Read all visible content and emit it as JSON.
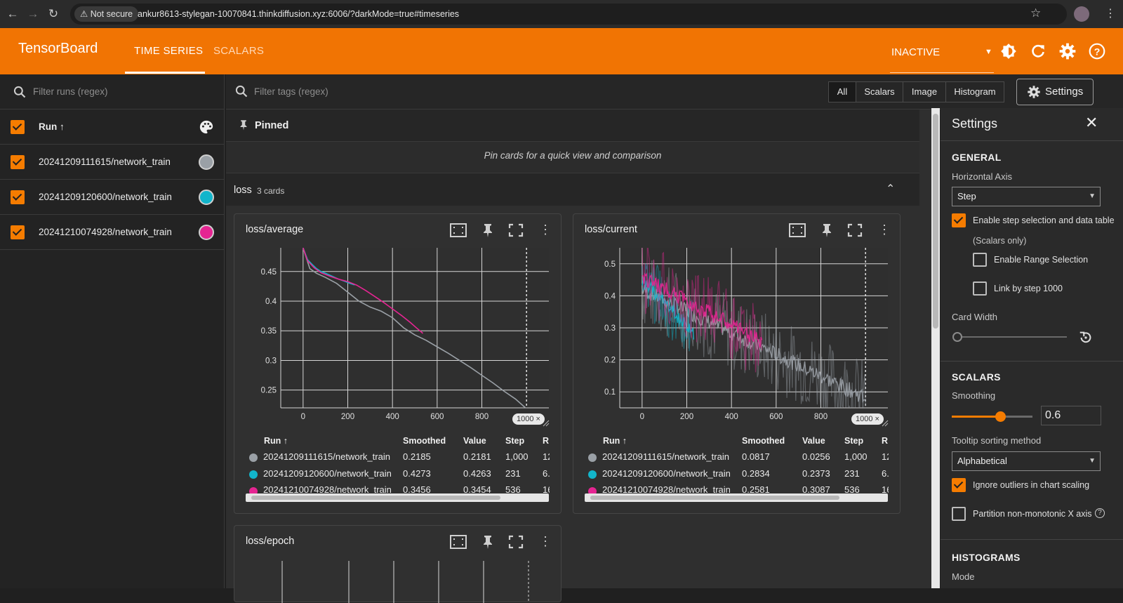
{
  "browser": {
    "security_label": "Not secure",
    "url": "ankur8613-stylegan-10070841.thinkdiffusion.xyz:6006/?darkMode=true#timeseries"
  },
  "header": {
    "brand": "TensorBoard",
    "tabs": [
      {
        "label": "TIME SERIES",
        "active": true
      },
      {
        "label": "SCALARS",
        "active": false
      }
    ],
    "status_selector": "INACTIVE"
  },
  "runs": {
    "filter_placeholder": "Filter runs (regex)",
    "column_label": "Run ↑",
    "items": [
      {
        "label": "20241209111615/network_train",
        "color": "#9aa0a6",
        "checked": true
      },
      {
        "label": "20241209120600/network_train",
        "color": "#12b5cb",
        "checked": true
      },
      {
        "label": "20241210074928/network_train",
        "color": "#e52592",
        "checked": true
      }
    ]
  },
  "toolbar": {
    "tag_filter_placeholder": "Filter tags (regex)",
    "type_filters": [
      "All",
      "Scalars",
      "Image",
      "Histogram"
    ],
    "active_type": "All",
    "settings_label": "Settings"
  },
  "pinned": {
    "title": "Pinned",
    "hint": "Pin cards for a quick view and comparison"
  },
  "group": {
    "name": "loss",
    "count_label": "3 cards"
  },
  "cards": [
    {
      "title": "loss/average",
      "step_badge": "1000",
      "table": {
        "headers": [
          "Run ↑",
          "Smoothed",
          "Value",
          "Step",
          "R"
        ],
        "rows": [
          {
            "run": "20241209111615/network_train",
            "color": "#9aa0a6",
            "smoothed": "0.2185",
            "value": "0.2181",
            "step": "1,000",
            "r": "12"
          },
          {
            "run": "20241209120600/network_train",
            "color": "#12b5cb",
            "smoothed": "0.4273",
            "value": "0.4263",
            "step": "231",
            "r": "6."
          },
          {
            "run": "20241210074928/network_train",
            "color": "#e52592",
            "smoothed": "0.3456",
            "value": "0.3454",
            "step": "536",
            "r": "16"
          }
        ]
      }
    },
    {
      "title": "loss/current",
      "step_badge": "1000",
      "table": {
        "headers": [
          "Run ↑",
          "Smoothed",
          "Value",
          "Step",
          "R"
        ],
        "rows": [
          {
            "run": "20241209111615/network_train",
            "color": "#9aa0a6",
            "smoothed": "0.0817",
            "value": "0.0256",
            "step": "1,000",
            "r": "12"
          },
          {
            "run": "20241209120600/network_train",
            "color": "#12b5cb",
            "smoothed": "0.2834",
            "value": "0.2373",
            "step": "231",
            "r": "6."
          },
          {
            "run": "20241210074928/network_train",
            "color": "#e52592",
            "smoothed": "0.2581",
            "value": "0.3087",
            "step": "536",
            "r": "16"
          }
        ]
      }
    },
    {
      "title": "loss/epoch"
    }
  ],
  "chart_data": [
    {
      "type": "line",
      "title": "loss/average",
      "xlim": [
        -100,
        1100
      ],
      "ylim": [
        0.22,
        0.49
      ],
      "x_ticks": [
        "0",
        "200",
        "400",
        "600",
        "800"
      ],
      "y_ticks": [
        "0.25",
        "0.3",
        "0.35",
        "0.4",
        "0.45"
      ],
      "series": [
        {
          "name": "20241209111615/network_train",
          "color": "#9aa0a6",
          "x": [
            0,
            30,
            60,
            100,
            150,
            200,
            250,
            300,
            350,
            400,
            450,
            500,
            550,
            600,
            650,
            700,
            750,
            800,
            850,
            900,
            950,
            1000
          ],
          "y": [
            0.49,
            0.455,
            0.447,
            0.44,
            0.43,
            0.415,
            0.4,
            0.39,
            0.383,
            0.372,
            0.355,
            0.343,
            0.334,
            0.323,
            0.312,
            0.3,
            0.288,
            0.275,
            0.262,
            0.248,
            0.235,
            0.2185
          ]
        },
        {
          "name": "20241209120600/network_train",
          "color": "#12b5cb",
          "x": [
            0,
            20,
            40,
            60,
            80,
            100,
            130,
            160,
            190,
            210,
            231
          ],
          "y": [
            0.49,
            0.47,
            0.462,
            0.455,
            0.45,
            0.447,
            0.442,
            0.437,
            0.433,
            0.43,
            0.4273
          ]
        },
        {
          "name": "20241210074928/network_train",
          "color": "#e52592",
          "x": [
            0,
            20,
            50,
            80,
            120,
            160,
            200,
            240,
            280,
            320,
            360,
            400,
            440,
            480,
            510,
            536
          ],
          "y": [
            0.49,
            0.468,
            0.456,
            0.448,
            0.442,
            0.437,
            0.433,
            0.427,
            0.418,
            0.408,
            0.398,
            0.387,
            0.376,
            0.364,
            0.354,
            0.3456
          ]
        }
      ]
    },
    {
      "type": "line",
      "title": "loss/current",
      "xlim": [
        -100,
        1100
      ],
      "ylim": [
        0.05,
        0.55
      ],
      "x_ticks": [
        "0",
        "200",
        "400",
        "600",
        "800"
      ],
      "y_ticks": [
        "0.1",
        "0.2",
        "0.3",
        "0.4",
        "0.5"
      ],
      "series": [
        {
          "name": "20241209111615/network_train",
          "color": "#9aa0a6",
          "x_range": [
            0,
            1000
          ],
          "y_start": 0.42,
          "y_end": 0.0817,
          "noise": 0.12
        },
        {
          "name": "20241209120600/network_train",
          "color": "#12b5cb",
          "x_range": [
            0,
            231
          ],
          "y_start": 0.45,
          "y_end": 0.2834,
          "noise": 0.1
        },
        {
          "name": "20241210074928/network_train",
          "color": "#e52592",
          "x_range": [
            0,
            536
          ],
          "y_start": 0.46,
          "y_end": 0.2581,
          "noise": 0.12
        }
      ]
    }
  ],
  "settings": {
    "title": "Settings",
    "general_title": "GENERAL",
    "horizontal_axis_label": "Horizontal Axis",
    "horizontal_axis_value": "Step",
    "enable_step_selection": "Enable step selection and data table",
    "scalars_only": "(Scalars only)",
    "enable_range": "Enable Range Selection",
    "link_by_step": "Link by step 1000",
    "card_width_label": "Card Width",
    "scalars_title": "SCALARS",
    "smoothing_label": "Smoothing",
    "smoothing_value": "0.6",
    "smoothing_fraction": 0.6,
    "tooltip_label": "Tooltip sorting method",
    "tooltip_value": "Alphabetical",
    "ignore_outliers": "Ignore outliers in chart scaling",
    "partition": "Partition non-monotonic X axis",
    "histograms_title": "HISTOGRAMS",
    "mode_label": "Mode"
  }
}
